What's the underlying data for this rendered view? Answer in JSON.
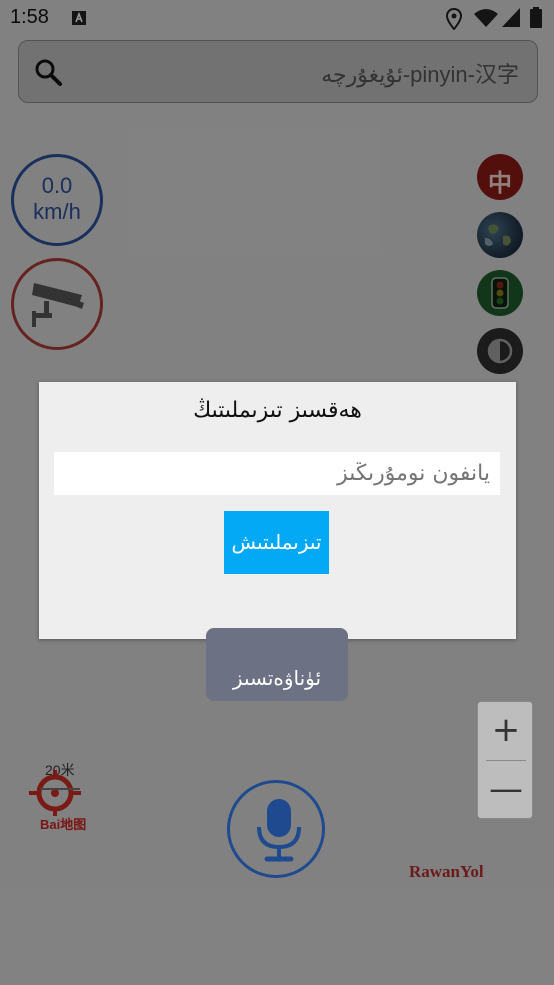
{
  "status_bar": {
    "time": "1:58",
    "icons": [
      "keyboard-notification-icon",
      "location-icon",
      "wifi-icon",
      "signal-icon",
      "battery-icon"
    ]
  },
  "search": {
    "placeholder": "ئۇيغۇرچە-pinyin-汉字"
  },
  "speedometer": {
    "value": "0.0",
    "unit": "km/h"
  },
  "side_buttons": {
    "language_label": "中",
    "items": [
      "language-icon",
      "globe-icon",
      "traffic-light-icon",
      "contrast-icon"
    ]
  },
  "dialog": {
    "title": "ھەقسىز تىزىملىتىڭ",
    "input_placeholder": "يانفون نومۇرىڭىز",
    "submit_label": "تىزىملىتىش"
  },
  "cancel_label": "ئۈناۋەتسىز",
  "zoom": {
    "in_label": "+",
    "out_label": "—"
  },
  "map": {
    "scale_label": "20米",
    "provider_label": "Bai地图"
  },
  "brand": "RawanYol",
  "colors": {
    "dialog_button": "#03a9f4",
    "speed_ring": "#2a4f9a",
    "camera_ring": "#a83a35",
    "mic_ring": "#1f4a8f",
    "cancel_pill": "#6c7183"
  }
}
